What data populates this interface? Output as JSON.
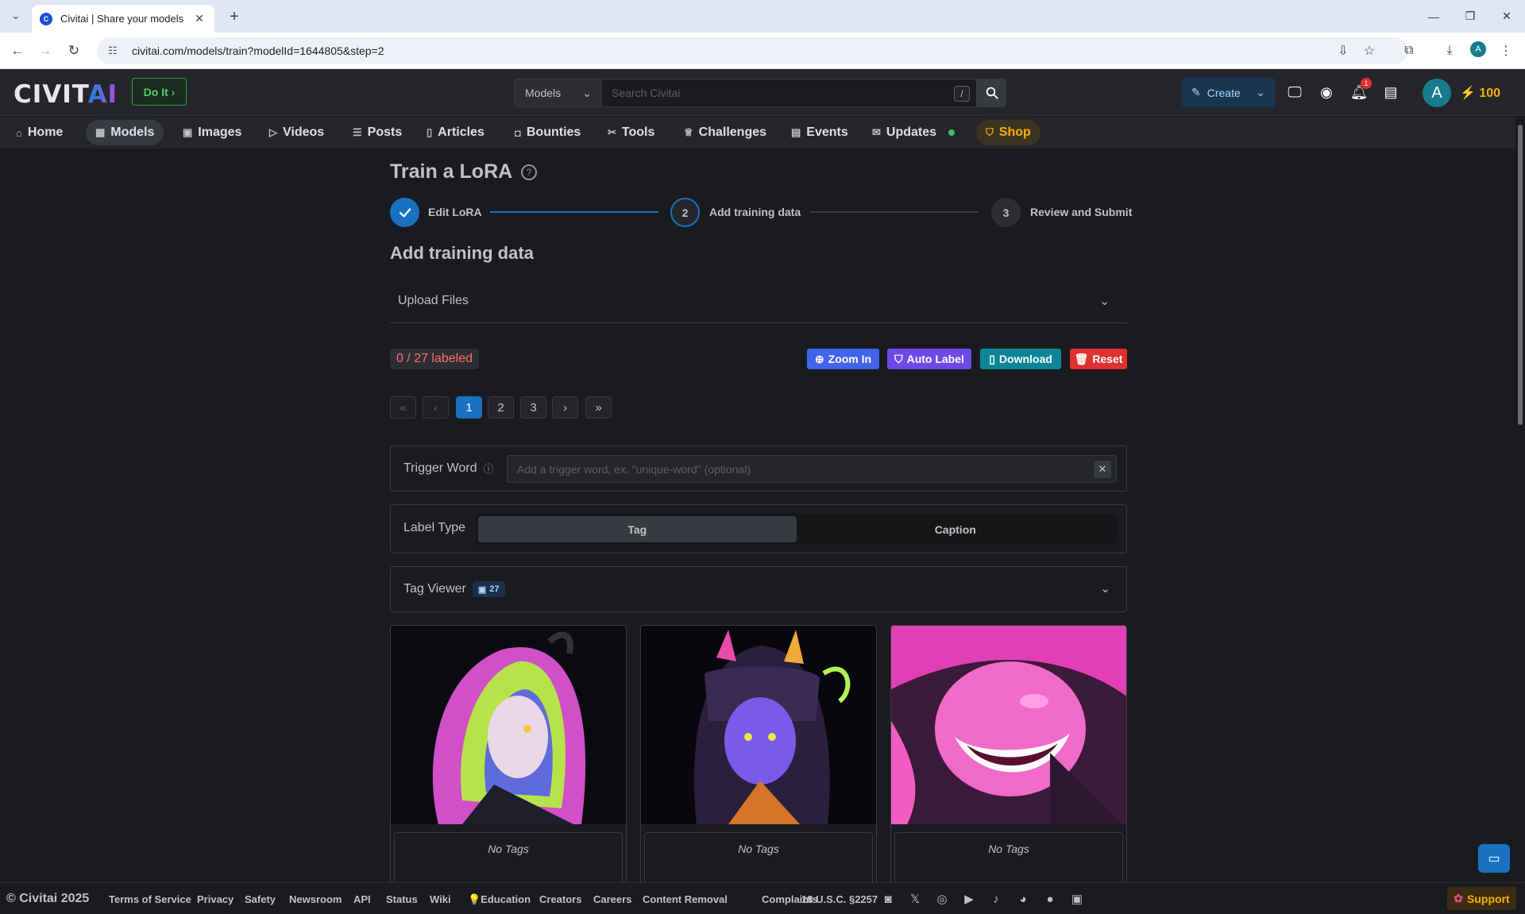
{
  "browser": {
    "tab_title": "Civitai | Share your models",
    "url": "civitai.com/models/train?modelId=1644805&step=2",
    "profile_initial": "A"
  },
  "header": {
    "logo_main": "CIVIT",
    "logo_ai": "AI",
    "do_it_label": "Do It ›",
    "search_category": "Models",
    "search_placeholder": "Search Civitai",
    "search_shortcut": "/",
    "create_label": "Create",
    "notification_count": "1",
    "avatar_initial": "A",
    "buzz_amount": "⚡ 100"
  },
  "nav": {
    "items": [
      {
        "label": "Home",
        "icon": "home-icon"
      },
      {
        "label": "Models",
        "icon": "grid-icon"
      },
      {
        "label": "Images",
        "icon": "image-icon"
      },
      {
        "label": "Videos",
        "icon": "video-icon"
      },
      {
        "label": "Posts",
        "icon": "posts-icon"
      },
      {
        "label": "Articles",
        "icon": "article-icon"
      },
      {
        "label": "Bounties",
        "icon": "bag-icon"
      },
      {
        "label": "Tools",
        "icon": "tools-icon"
      },
      {
        "label": "Challenges",
        "icon": "trophy-icon"
      },
      {
        "label": "Events",
        "icon": "calendar-icon"
      },
      {
        "label": "Updates",
        "icon": "updates-icon"
      },
      {
        "label": "Shop",
        "icon": "shopping-bag-icon"
      }
    ]
  },
  "page": {
    "title": "Train a LoRA",
    "steps": [
      {
        "number": "✓",
        "label": "Edit LoRA",
        "state": "done"
      },
      {
        "number": "2",
        "label": "Add training data",
        "state": "active"
      },
      {
        "number": "3",
        "label": "Review and Submit",
        "state": "pending"
      }
    ],
    "section_title": "Add training data",
    "upload_label": "Upload Files",
    "labeled_status": "0 / 27 labeled",
    "buttons": {
      "zoom_in": "Zoom In",
      "auto_label": "Auto Label",
      "download": "Download",
      "reset": "Reset"
    },
    "pagination": {
      "first": "«",
      "prev": "‹",
      "pages": [
        "1",
        "2",
        "3"
      ],
      "current": "1",
      "next": "›",
      "last": "»"
    },
    "trigger_word": {
      "label": "Trigger Word",
      "placeholder": "Add a trigger word, ex. \"unique-word\" (optional)"
    },
    "label_type": {
      "label": "Label Type",
      "options": [
        "Tag",
        "Caption"
      ],
      "selected": "Tag"
    },
    "tag_viewer": {
      "label": "Tag Viewer",
      "count": "27"
    },
    "cards": [
      {
        "tags_text": "No Tags"
      },
      {
        "tags_text": "No Tags"
      },
      {
        "tags_text": "No Tags"
      }
    ]
  },
  "footer": {
    "copyright": "© Civitai 2025",
    "links": [
      "Terms of Service",
      "Privacy",
      "Safety",
      "Newsroom",
      "API",
      "Status",
      "Wiki",
      "💡Education",
      "Creators",
      "Careers",
      "Content Removal",
      "Complaints",
      "18 U.S.C. §2257"
    ],
    "support_label": "Support"
  },
  "colors": {
    "primary": "#1971c2",
    "zoom_in": "#4263eb",
    "auto_label": "#7048e8",
    "download": "#0c8599",
    "reset": "#e03131",
    "shop": "#fab005"
  }
}
